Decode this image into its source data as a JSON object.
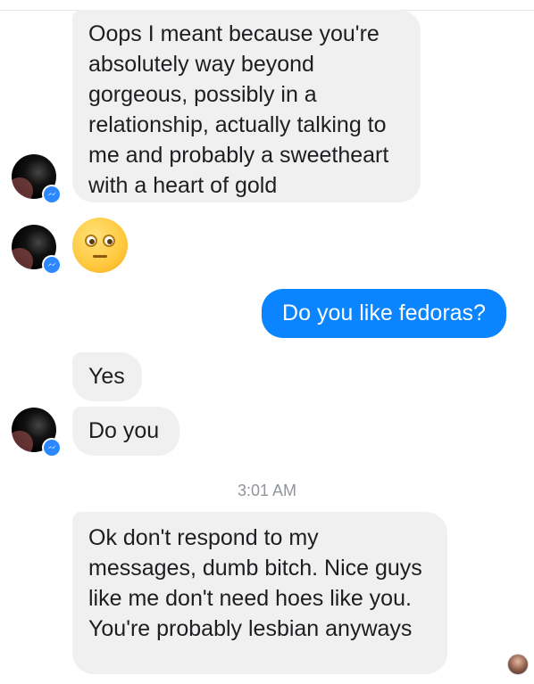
{
  "messages": {
    "m1": "Oops I meant because you're absolutely way beyond gorgeous, possibly in a relationship, actually talking to me and probably a sweetheart with a heart of gold",
    "m2_emoji": "flushed-face-emoji",
    "m3": "Do you like fedoras?",
    "m4": "Yes",
    "m5": "Do you",
    "m6": "Ok don't respond to my messages, dumb bitch. Nice guys like me don't need hoes like you. You're probably lesbian anyways"
  },
  "timestamp": "3:01 AM",
  "colors": {
    "incoming_bubble": "#f1f0f0",
    "outgoing_bubble": "#0a84ff",
    "messenger_badge": "#2d88ff",
    "timestamp": "#90949c"
  }
}
